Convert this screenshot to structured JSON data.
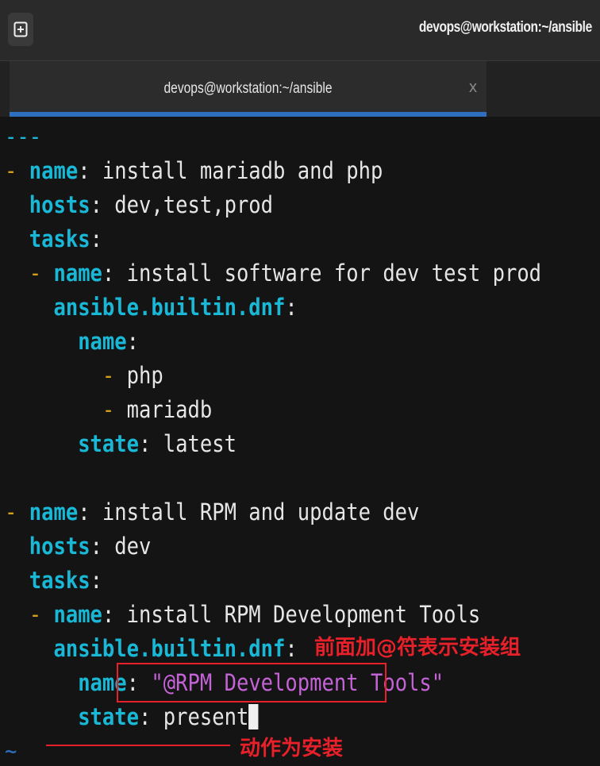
{
  "window": {
    "title": "devops@workstation:~/ansible"
  },
  "tab": {
    "label": "devops@workstation:~/ansible",
    "close": "x"
  },
  "icons": {
    "new_tab": "new-tab-icon",
    "close": "close-icon"
  },
  "colors": {
    "key": "#19b8d6",
    "dash": "#d4a017",
    "string": "#c463d6",
    "annotation": "#e8202a",
    "tab_indicator": "#2f6fc0"
  },
  "code": {
    "l0": "---",
    "l1_dash": "- ",
    "l1_key": "name",
    "l1_val": " install mariadb and php",
    "l2_key": "hosts",
    "l2_val": " dev,test,prod",
    "l3_key": "tasks",
    "l4_dash": "- ",
    "l4_key": "name",
    "l4_val": " install software for dev test prod",
    "l5_key": "ansible.builtin.dnf",
    "l6_key": "name",
    "l7_dash": "- ",
    "l7_val": "php",
    "l8_dash": "- ",
    "l8_val": "mariadb",
    "l9_key": "state",
    "l9_val": " latest",
    "l11_dash": "- ",
    "l11_key": "name",
    "l11_val": " install RPM and update dev",
    "l12_key": "hosts",
    "l12_val": " dev",
    "l13_key": "tasks",
    "l14_dash": "- ",
    "l14_key": "name",
    "l14_val": " install RPM Development Tools",
    "l15_key": "ansible.builtin.dnf",
    "l16_key": "name",
    "l16_str": "\"@RPM Development Tools\"",
    "l17_key": "state",
    "l17_val": " present",
    "l18_tilde": "~",
    "colon": ":"
  },
  "annotations": {
    "group_note": "前面加@符表示安装组",
    "action_note": "动作为安装"
  }
}
